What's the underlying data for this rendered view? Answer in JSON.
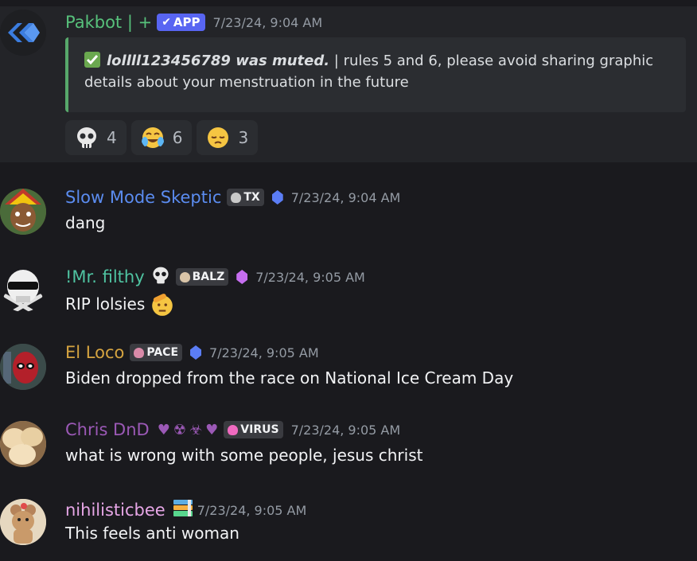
{
  "bot_message": {
    "username": "Pakbot | +",
    "app_badge": "APP",
    "timestamp": "7/23/24, 9:04 AM",
    "embed": {
      "bold_text": "lollll123456789 was muted.",
      "text": " | rules 5 and 6, please avoid sharing graphic details about your menstruation in the future"
    },
    "reactions": [
      {
        "emoji": "skull-icon",
        "count": "4"
      },
      {
        "emoji": "laughing-crying-icon",
        "count": "6"
      },
      {
        "emoji": "pensive-icon",
        "count": "3"
      }
    ]
  },
  "messages": [
    {
      "username": "Slow Mode Skeptic",
      "tag": "TX",
      "timestamp": "7/23/24, 9:04 AM",
      "text": "dang",
      "color": "#5b8cf0"
    },
    {
      "username": "!Mr. filthy",
      "tag": "BALZ",
      "timestamp": "7/23/24, 9:05 AM",
      "text": "RIP lolsies",
      "color": "#4fc3a1"
    },
    {
      "username": "El Loco",
      "tag": "PACE",
      "timestamp": "7/23/24, 9:05 AM",
      "text": "Biden dropped from the race on National Ice Cream Day",
      "color": "#d6a440"
    },
    {
      "username": "Chris DnD",
      "tag": "VIRUS",
      "timestamp": "7/23/24, 9:05 AM",
      "text": "what is wrong with some people, jesus christ",
      "color": "#9b59b6"
    },
    {
      "username": "nihilisticbee",
      "timestamp": "7/23/24, 9:05 AM",
      "text": "This feels anti woman",
      "color": "#e6a6e6"
    }
  ],
  "colors": {
    "accent": "#5865f2",
    "embed_border": "#57a86b",
    "bot_name": "#57c17b"
  }
}
